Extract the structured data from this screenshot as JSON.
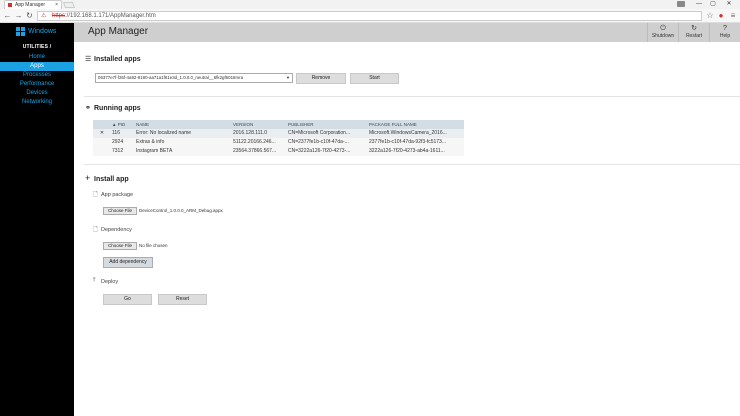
{
  "browser": {
    "tab_title": "App Manager",
    "tab_close": "×",
    "url_scheme": "https",
    "url_rest": "://192.168.1.171/AppManager.htm",
    "window_controls": [
      "—",
      "▢",
      "✕"
    ]
  },
  "sidebar": {
    "logo_text": "Windows",
    "heading": "UTILITIES /",
    "items": [
      {
        "label": "Home"
      },
      {
        "label": "Apps"
      },
      {
        "label": "Processes"
      },
      {
        "label": "Performance"
      },
      {
        "label": "Devices"
      },
      {
        "label": "Networking"
      }
    ],
    "accent": "#1ba1e2"
  },
  "header": {
    "title": "App Manager",
    "buttons": [
      {
        "label": "Shutdown",
        "icon": "power-icon"
      },
      {
        "label": "Restart",
        "icon": "restart-icon"
      },
      {
        "label": "Help",
        "icon": "help-icon"
      }
    ]
  },
  "installed": {
    "title": "Installed apps",
    "selected_app": "06377e7f-f26f-4a92-8190-aa71a1f61e3d_1.0.0.0_neutral__6fk2gf6018mra",
    "remove_label": "Remove",
    "start_label": "Start"
  },
  "running": {
    "title": "Running apps",
    "columns": [
      "",
      "▲ PID",
      "NAME",
      "VERSION",
      "PUBLISHER",
      "PACKAGE FULL NAME"
    ],
    "rows": [
      {
        "close": "✕",
        "pid": "116",
        "name": "Error: No localized name",
        "version": "2016.128.111.0",
        "publisher": "CN=Microsoft Corporation...",
        "package": "Microsoft.WindowsCamera_2016..."
      },
      {
        "close": "",
        "pid": "2924",
        "name": "Extras & info",
        "version": "51122.20166.246...",
        "publisher": "CN=2377fe1b-c10f-47da-...",
        "package": "2377fe1b-c10f-47da-92f3-fc5173..."
      },
      {
        "close": "",
        "pid": "7312",
        "name": "Instagram BETA",
        "version": "23564.37866.567...",
        "publisher": "CN=3222a126-7f20-4273-...",
        "package": "3222a126-7f20-4273-ab4a-1611..."
      }
    ]
  },
  "install": {
    "title": "Install app",
    "app_package_label": "App package",
    "choose_file_label": "Choose File",
    "app_package_file": "DeviceControl_1.0.0.0_ARM_Debug.appx",
    "dependency_label": "Dependency",
    "dependency_file": "No file chosen",
    "add_dependency_label": "Add dependency",
    "deploy_label": "Deploy",
    "go_label": "Go",
    "reset_label": "Reset"
  }
}
